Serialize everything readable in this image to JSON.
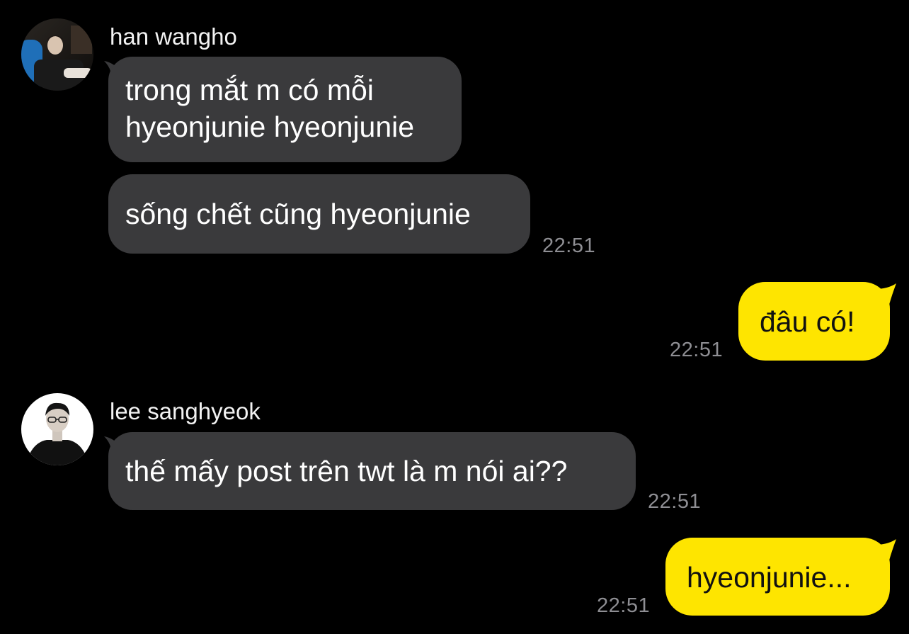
{
  "colors": {
    "background": "#000000",
    "incoming_bubble": "#3a3a3c",
    "outgoing_bubble": "#fee500",
    "timestamp": "#8e8e93"
  },
  "conversation": {
    "group1": {
      "sender_name": "han wangho",
      "avatar_icon": "user-photo-avatar",
      "message1_line1": "trong mắt m có mỗi",
      "message1_line2": "hyeonjunie hyeonjunie",
      "message2": "sống chết cũng hyeonjunie",
      "time": "22:51"
    },
    "outgoing1": {
      "message": "đâu có!",
      "time": "22:51"
    },
    "group2": {
      "sender_name": "lee sanghyeok",
      "avatar_icon": "user-photo-avatar",
      "message": "thế mấy post trên twt là m nói ai??",
      "time": "22:51"
    },
    "outgoing2": {
      "message": "hyeonjunie...",
      "time": "22:51"
    }
  }
}
